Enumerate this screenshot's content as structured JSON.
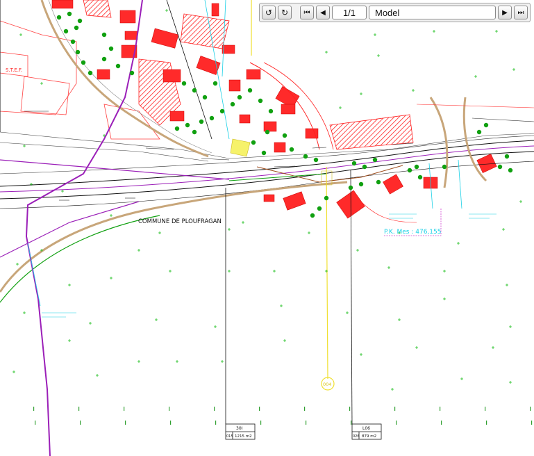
{
  "toolbar": {
    "undo_icon": "rotate-left-icon",
    "redo_icon": "rotate-right-icon",
    "first_icon": "skip-first-icon",
    "prev_icon": "triangle-left-icon",
    "page": "1/1",
    "layout": "Model",
    "next_icon": "triangle-right-icon",
    "last_icon": "skip-last-icon"
  },
  "map": {
    "commune_label": "COMMUNE DE PLOUFRAGAN",
    "stef_label": "S.T.E.F.",
    "pk_label": "P.K. Mes : 476,155",
    "marker_label": "004",
    "parcel_left": {
      "name": "30I",
      "code": "015",
      "area": "1215 m2"
    },
    "parcel_right": {
      "name": "L06",
      "code": "026",
      "area": "879 m2"
    }
  },
  "colors": {
    "building_red": "#ff2020",
    "rail_purple": "#9b1fb8",
    "vegetation_green": "#10a010",
    "annotation_cyan": "#19d0e6",
    "axis_yellow": "#f0e030",
    "line_black": "#111111",
    "road_tan": "#c8a67a"
  }
}
